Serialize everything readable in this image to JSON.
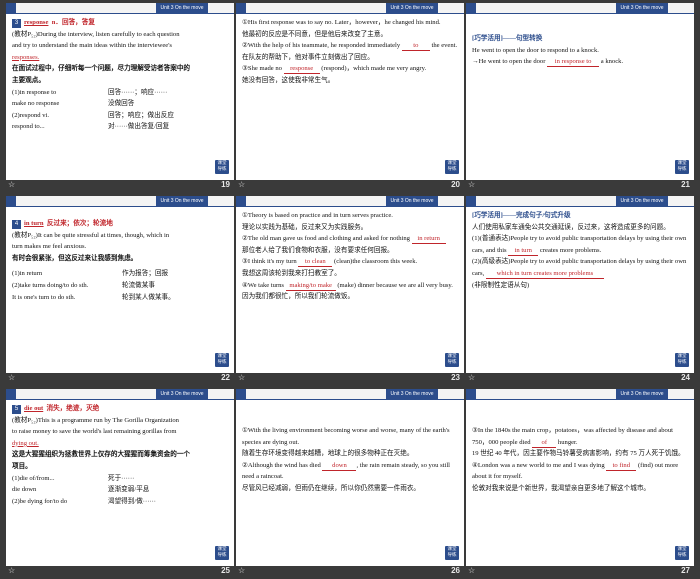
{
  "unit_tag": "Unit 3  On the move",
  "nav_label": "课堂\n导练",
  "star_glyph": "☆",
  "slides": [
    {
      "page": "19",
      "badge": "3",
      "headword": "response",
      "headword_gloss": "n．回答，答复",
      "lines": [
        "(教材P₅₂)During the interview, listen carefully to each question",
        "and try to understand the main ideas within the interviewee's",
        "responses.",
        "在面试过程中，仔细听每一个问题，尽力理解受访者答案中的",
        "主要观点。"
      ],
      "pairs": [
        [
          "(1)in response to",
          "回答······；响应······"
        ],
        [
          "make no response",
          "没做回答"
        ],
        [
          "(2)respond vi.",
          "回答；响应；做出反应"
        ],
        [
          "respond to...",
          "对······做出答复/回复"
        ]
      ]
    },
    {
      "page": "20",
      "p1": "①His first response was to say no. Later，however，he changed his mind.",
      "p1_cn": "他最初的反应是不同意，但是他后来改变了主意。",
      "p2a": "②With the help of his teammate, he responded immediately",
      "p2_blank": "to",
      "p2b": "the event.",
      "p2_cn": "在队友的帮助下，他对事件立刻做出了回应。",
      "p3a": "③She made no",
      "p3_blank": "response",
      "p3b": "(respond)，which made me very angry.",
      "p3_cn": "她没有回答，这使我非常生气。"
    },
    {
      "page": "21",
      "tip": "[巧学活用]——句型转换",
      "l1": "He went to open the door to respond to a knock.",
      "l2a": "→He went to open the door",
      "l2_blank": "in response to",
      "l2b": "a knock."
    },
    {
      "page": "22",
      "badge": "4",
      "headword": "in turn",
      "headword_gloss": "反过来；依次；轮流地",
      "lines": [
        "(教材P₅₂)It can be quite stressful at times, though, which in",
        "turn makes me feel anxious.",
        "有时会很紧张，但这反过来让我感到焦虑。"
      ],
      "pairs": [
        [
          "(1)in return",
          "作为报答；回报"
        ],
        [
          "(2)take turns doing/to do sth.",
          "轮流做某事"
        ],
        [
          "It is one's turn to do sth.",
          "轮到某人做某事。"
        ]
      ]
    },
    {
      "page": "23",
      "p1": "①Theory is based on practice and in turn serves practice.",
      "p1_cn": "理论以实践为基础，反过来又为实践服务。",
      "p2a": "②The old man gave us food and clothing and asked for nothing",
      "p2_blank": "in return",
      "p2_cn": "那位老人给了我们食物和衣服，没有要求任何回报。",
      "p3a": "③I think it's my turn",
      "p3_blank": "to clean",
      "p3b": "(clean)the classroom this week.",
      "p3_cn": "我想这周该轮到我来打扫教室了。",
      "p4a": "④We take turns",
      "p4_blank": "making/to make",
      "p4b": "(make) dinner because we are all very busy.",
      "p4_cn": "因为我们都很忙，所以我们轮流做饭。"
    },
    {
      "page": "24",
      "tip": "[巧学活用]——完成句子/句式升级",
      "l1": "人们使用私家车通免公共交通延误，反过来，这将造成更多的问题。",
      "l2a": "(1)(普通表达)People try to avoid public transportation delays by using their own cars, and this",
      "l2_blank": "in turn",
      "l2b": "creates more problems.",
      "l3a": "(2)(高级表达)People try to avoid public transportation delays by using their own cars,",
      "l3_blank": "which in turn creates more problems",
      "l3_tail": "(非限制性定语从句)"
    },
    {
      "page": "25",
      "badge": "5",
      "headword": "die out",
      "headword_gloss": "消失，绝迹，灭绝",
      "lines": [
        "(教材P₅₂)This is a programme run by The Gorilla Organization",
        "to raise money to save the world's last remaining gorillas from",
        "dying out.",
        "这是大猩猩组织为拯救世界上仅存的大猩猩而筹集资金的一个",
        "项目。"
      ],
      "pairs": [
        [
          "(1)die of/from...",
          "死于······"
        ],
        [
          "die down",
          "逐渐变弱/平息"
        ],
        [
          "(2)be dying for/to do",
          "渴望得到/做······"
        ]
      ]
    },
    {
      "page": "26",
      "p1": "①With the living environment becoming worse and worse, many of the earth's species are dying out.",
      "p1_cn": "随着生存环境变得越来越糟，地球上的很多物种正在灭绝。",
      "p2a": "②Although the wind has died",
      "p2_blank": "down",
      "p2b": ", the rain remain steady, so you still need a raincoat.",
      "p2_cn": "尽管风已经减弱，但雨仍在继续，所以你仍然需要一件雨衣。"
    },
    {
      "page": "27",
      "p1": "③In the 1840s the main crop，potatoes，was affected by disease and about 750，000 people died",
      "p1_blank": "of",
      "p1b": "hunger.",
      "p1_cn": "19 世纪 40 年代，因主要作物马铃薯受病害影响，约有 75 万人死于饥饿。",
      "p2a": "④London was a new world to me and I was dying",
      "p2_blank": "to find",
      "p2b": "(find) out more about it for myself.",
      "p2_cn": "伦敦对我来说是个新世界，我渴望亲自更多地了解这个城市。"
    }
  ]
}
